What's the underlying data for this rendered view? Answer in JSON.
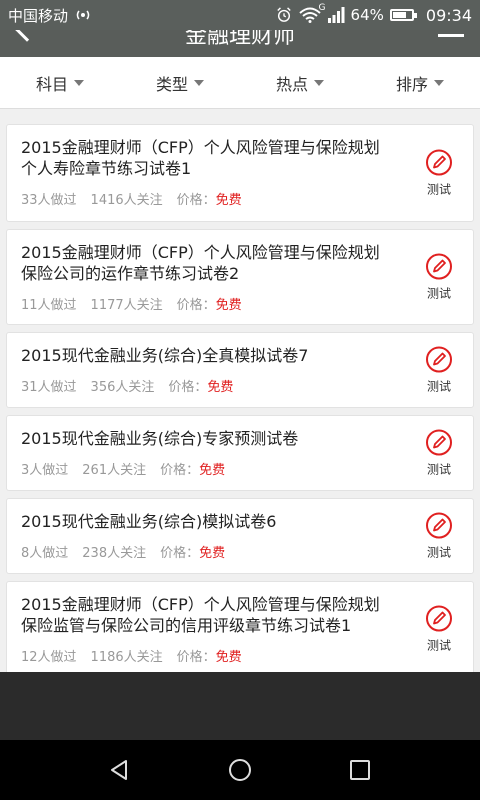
{
  "status_bar": {
    "carrier": "中国移动",
    "battery_percent": "64%",
    "battery_level": 0.64,
    "time": "09:34",
    "network_badge": "G",
    "icons": [
      "radio-icon",
      "alarm-icon",
      "wifi-icon",
      "signal-icon",
      "battery-icon"
    ]
  },
  "header": {
    "title": "金融理财师",
    "back_icon": "back-arrow-icon",
    "menu_icon": "menu-icon"
  },
  "filters": [
    {
      "label": "科目"
    },
    {
      "label": "类型"
    },
    {
      "label": "热点"
    },
    {
      "label": "排序"
    }
  ],
  "items": [
    {
      "title": "2015金融理财师（CFP）个人风险管理与保险规划个人寿险章节练习试卷1",
      "done": "33人做过",
      "follow": "1416人关注",
      "price_label": "价格：",
      "price": "免费",
      "action": "测试"
    },
    {
      "title": "2015金融理财师（CFP）个人风险管理与保险规划保险公司的运作章节练习试卷2",
      "done": "11人做过",
      "follow": "1177人关注",
      "price_label": "价格：",
      "price": "免费",
      "action": "测试"
    },
    {
      "title": "2015现代金融业务(综合)全真模拟试卷7",
      "done": "31人做过",
      "follow": "356人关注",
      "price_label": "价格：",
      "price": "免费",
      "action": "测试"
    },
    {
      "title": "2015现代金融业务(综合)专家预测试卷",
      "done": "3人做过",
      "follow": "261人关注",
      "price_label": "价格：",
      "price": "免费",
      "action": "测试"
    },
    {
      "title": "2015现代金融业务(综合)模拟试卷6",
      "done": "8人做过",
      "follow": "238人关注",
      "price_label": "价格：",
      "price": "免费",
      "action": "测试"
    },
    {
      "title": "2015金融理财师（CFP）个人风险管理与保险规划保险监管与保险公司的信用评级章节练习试卷1",
      "done": "12人做过",
      "follow": "1186人关注",
      "price_label": "价格：",
      "price": "免费",
      "action": "测试"
    }
  ],
  "colors": {
    "accent_red": "#e02020",
    "status_bar_bg": "#5a5f5c",
    "nav_bg": "#000000"
  },
  "nav": [
    "back-triangle-icon",
    "home-circle-icon",
    "recents-square-icon"
  ]
}
